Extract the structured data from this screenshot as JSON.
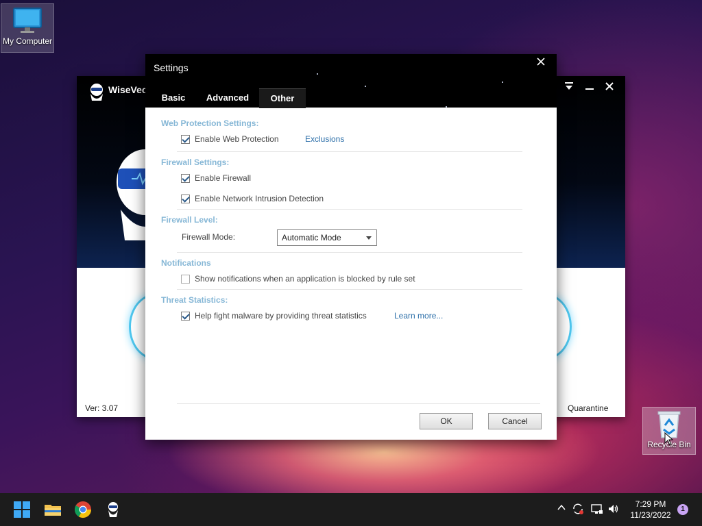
{
  "desktop": {
    "my_computer_label": "My Computer",
    "recycle_bin_label": "Recycle Bin"
  },
  "app_window": {
    "title": "WiseVec",
    "version": "Ver: 3.07",
    "quarantine_label": "Quarantine"
  },
  "settings_dialog": {
    "title": "Settings",
    "close_icon": "close-icon",
    "tabs": [
      {
        "label": "Basic",
        "active": false
      },
      {
        "label": "Advanced",
        "active": false
      },
      {
        "label": "Other",
        "active": true
      }
    ],
    "web_protection": {
      "heading": "Web Protection Settings:",
      "enable_label": "Enable Web Protection",
      "enable_checked": true,
      "exclusions_link": "Exclusions"
    },
    "firewall": {
      "heading": "Firewall Settings:",
      "enable_label": "Enable Firewall",
      "enable_checked": true,
      "nids_label": "Enable Network Intrusion Detection",
      "nids_checked": true
    },
    "firewall_level": {
      "heading": "Firewall Level:",
      "mode_label": "Firewall Mode:",
      "mode_value": "Automatic Mode"
    },
    "notifications": {
      "heading": "Notifications",
      "show_label": "Show notifications when an application is blocked by rule set",
      "show_checked": false
    },
    "threat_statistics": {
      "heading": "Threat Statistics:",
      "help_label": "Help fight malware by providing threat statistics",
      "help_checked": true,
      "learn_more_link": "Learn more..."
    },
    "ok_label": "OK",
    "cancel_label": "Cancel"
  },
  "taskbar": {
    "time": "7:29 PM",
    "date": "11/23/2022",
    "notification_count": "1"
  },
  "colors": {
    "section_heading": "#86b7d6",
    "link": "#2b6ea8",
    "dialog_header": "#000000",
    "taskbar": "#1c1c1c"
  }
}
